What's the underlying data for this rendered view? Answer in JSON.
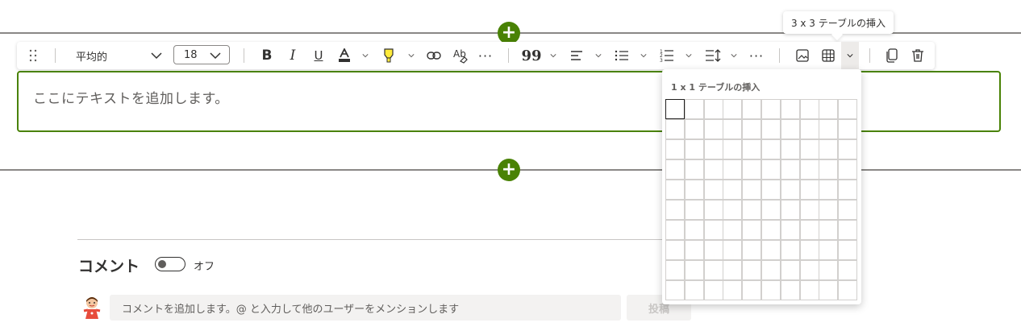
{
  "toolbar": {
    "font_name": "平均的",
    "font_size": "18",
    "icons": [
      "drag-handle-icon",
      "bold-icon",
      "italic-icon",
      "underline-icon",
      "font-color-icon",
      "highlight-icon",
      "link-icon",
      "clear-format-icon",
      "more-icon",
      "quote-icon",
      "align-icon",
      "bullets-icon",
      "numbering-icon",
      "line-spacing-icon",
      "more-icon",
      "image-icon",
      "table-icon",
      "copy-icon",
      "delete-icon"
    ],
    "accent_color": "#498205",
    "highlight_color": "#ffeb3b"
  },
  "editor": {
    "placeholder": "ここにテキストを追加します。"
  },
  "tooltip": {
    "text": "3 x 3 テーブルの挿入"
  },
  "table_picker": {
    "title": "1 x 1 テーブルの挿入",
    "rows": 10,
    "cols": 10,
    "selected_rows": 1,
    "selected_cols": 1
  },
  "comments": {
    "title": "コメント",
    "toggle_state": "オフ",
    "input_placeholder": "コメントを追加します。@ と入力して他のユーザーをメンションします",
    "post_label": "投稿"
  }
}
